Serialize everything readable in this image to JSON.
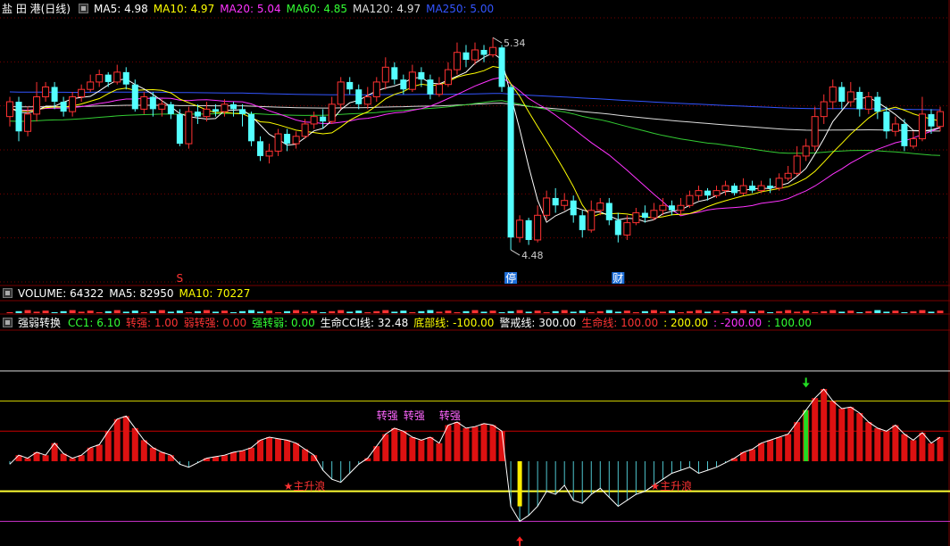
{
  "header_main": {
    "stock_name": "盐 田 港(日线)",
    "items": [
      {
        "label": "MA5: ",
        "value": "4.98",
        "color": "#ffffff"
      },
      {
        "label": "MA10: ",
        "value": "4.97",
        "color": "#ffff00"
      },
      {
        "label": "MA20: ",
        "value": "5.04",
        "color": "#ff33ff"
      },
      {
        "label": "MA60: ",
        "value": "4.85",
        "color": "#33ff33"
      },
      {
        "label": "MA120: ",
        "value": "4.97",
        "color": "#dddddd"
      },
      {
        "label": "MA250: ",
        "value": "5.00",
        "color": "#3355ff"
      }
    ]
  },
  "header_volume": {
    "items": [
      {
        "label": "VOLUME: ",
        "value": "64322",
        "color": "#ffffff"
      },
      {
        "label": "MA5: ",
        "value": "82950",
        "color": "#ffffff"
      },
      {
        "label": "MA10: ",
        "value": "70227",
        "color": "#ffff00"
      }
    ]
  },
  "header_indicator": {
    "name": "强弱转换",
    "items": [
      {
        "label": "CC1: ",
        "value": "6.10",
        "color": "#33ff33"
      },
      {
        "label": "转强: ",
        "value": "1.00",
        "color": "#ff3333"
      },
      {
        "label": "弱转强: ",
        "value": "0.00",
        "color": "#ff3333"
      },
      {
        "label": "强转弱: ",
        "value": "0.00",
        "color": "#33ff33"
      },
      {
        "label": "生命CCI线: ",
        "value": "32.48",
        "color": "#ffffff"
      },
      {
        "label": "底部线: ",
        "value": "-100.00",
        "color": "#ffff00"
      },
      {
        "label": "警戒线: ",
        "value": "300.00",
        "color": "#ffffff"
      },
      {
        "label": "生命线: ",
        "value": "100.00",
        "color": "#ff3333"
      },
      {
        "label": ": ",
        "value": "200.00",
        "color": "#ffff00"
      },
      {
        "label": ": ",
        "value": "-200.00",
        "color": "#ff33ff"
      },
      {
        "label": ": ",
        "value": "100.00",
        "color": "#33ff33"
      }
    ]
  },
  "annotations": {
    "high_label": "5.34",
    "low_label": "4.48",
    "marker_s": "S",
    "marker_ting": "停",
    "marker_cai": "财",
    "signal_1": "主升浪",
    "signal_2": "主升浪",
    "text_a": "转强",
    "text_b": "转强",
    "text_c": "转强"
  },
  "colors": {
    "up": "#ff3232",
    "down": "#54ffff",
    "ma5": "#ffffff",
    "ma10": "#ffff00",
    "ma20": "#ff33ff",
    "ma60": "#33cc33",
    "ma120": "#dddddd",
    "ma250": "#3355ff",
    "grid": "#7a0000",
    "frame": "#7a0000"
  },
  "chart_data": {
    "type": "candlestick",
    "ylim": [
      4.35,
      5.42
    ],
    "high": 5.34,
    "low": 4.48,
    "candles": [
      [
        5.02,
        5.08,
        4.98,
        5.1
      ],
      [
        5.08,
        4.96,
        4.92,
        5.1
      ],
      [
        4.96,
        5.03,
        4.94,
        5.06
      ],
      [
        5.03,
        5.1,
        5.0,
        5.16
      ],
      [
        5.1,
        5.14,
        5.08,
        5.16
      ],
      [
        5.14,
        5.08,
        5.05,
        5.16
      ],
      [
        5.08,
        5.04,
        5.02,
        5.1
      ],
      [
        5.04,
        5.1,
        5.02,
        5.12
      ],
      [
        5.1,
        5.13,
        5.08,
        5.15
      ],
      [
        5.13,
        5.16,
        5.12,
        5.19
      ],
      [
        5.16,
        5.19,
        5.14,
        5.21
      ],
      [
        5.19,
        5.16,
        5.14,
        5.2
      ],
      [
        5.16,
        5.2,
        5.15,
        5.23
      ],
      [
        5.2,
        5.15,
        5.13,
        5.22
      ],
      [
        5.15,
        5.05,
        5.04,
        5.17
      ],
      [
        5.05,
        5.1,
        5.03,
        5.12
      ],
      [
        5.1,
        5.05,
        5.02,
        5.12
      ],
      [
        5.05,
        5.07,
        5.02,
        5.09
      ],
      [
        5.07,
        5.03,
        5.01,
        5.08
      ],
      [
        5.03,
        4.91,
        4.9,
        5.05
      ],
      [
        4.91,
        5.04,
        4.89,
        5.06
      ],
      [
        5.04,
        5.02,
        4.99,
        5.07
      ],
      [
        5.02,
        5.05,
        5.0,
        5.08
      ],
      [
        5.05,
        5.04,
        5.02,
        5.07
      ],
      [
        5.04,
        5.07,
        5.02,
        5.09
      ],
      [
        5.07,
        5.05,
        5.02,
        5.08
      ],
      [
        5.05,
        5.03,
        4.98,
        5.07
      ],
      [
        5.03,
        4.92,
        4.9,
        5.04
      ],
      [
        4.92,
        4.86,
        4.84,
        4.94
      ],
      [
        4.86,
        4.88,
        4.83,
        4.91
      ],
      [
        4.88,
        4.95,
        4.86,
        4.97
      ],
      [
        4.95,
        4.91,
        4.88,
        4.97
      ],
      [
        4.91,
        4.94,
        4.89,
        4.96
      ],
      [
        4.94,
        4.99,
        4.93,
        5.01
      ],
      [
        4.99,
        5.02,
        4.97,
        5.04
      ],
      [
        5.02,
        5.0,
        4.97,
        5.05
      ],
      [
        5.0,
        5.07,
        4.99,
        5.1
      ],
      [
        5.07,
        5.16,
        5.05,
        5.18
      ],
      [
        5.16,
        5.13,
        5.11,
        5.18
      ],
      [
        5.13,
        5.07,
        5.05,
        5.15
      ],
      [
        5.07,
        5.1,
        5.05,
        5.14
      ],
      [
        5.1,
        5.16,
        5.08,
        5.18
      ],
      [
        5.16,
        5.22,
        5.13,
        5.26
      ],
      [
        5.22,
        5.17,
        5.15,
        5.24
      ],
      [
        5.17,
        5.13,
        5.11,
        5.19
      ],
      [
        5.13,
        5.2,
        5.12,
        5.23
      ],
      [
        5.2,
        5.17,
        5.14,
        5.22
      ],
      [
        5.17,
        5.11,
        5.09,
        5.19
      ],
      [
        5.11,
        5.15,
        5.1,
        5.18
      ],
      [
        5.15,
        5.21,
        5.14,
        5.24
      ],
      [
        5.21,
        5.28,
        5.19,
        5.32
      ],
      [
        5.28,
        5.25,
        5.22,
        5.31
      ],
      [
        5.25,
        5.29,
        5.23,
        5.32
      ],
      [
        5.29,
        5.27,
        5.24,
        5.31
      ],
      [
        5.27,
        5.3,
        5.26,
        5.34
      ],
      [
        5.3,
        5.14,
        5.12,
        5.31
      ],
      [
        5.14,
        4.53,
        4.48,
        5.15
      ],
      [
        4.53,
        4.6,
        4.51,
        4.62
      ],
      [
        4.6,
        4.52,
        4.5,
        4.61
      ],
      [
        4.52,
        4.62,
        4.51,
        4.66
      ],
      [
        4.62,
        4.69,
        4.6,
        4.72
      ],
      [
        4.69,
        4.66,
        4.63,
        4.73
      ],
      [
        4.66,
        4.68,
        4.64,
        4.71
      ],
      [
        4.68,
        4.62,
        4.59,
        4.7
      ],
      [
        4.62,
        4.56,
        4.53,
        4.64
      ],
      [
        4.56,
        4.64,
        4.55,
        4.68
      ],
      [
        4.64,
        4.67,
        4.62,
        4.69
      ],
      [
        4.67,
        4.6,
        4.58,
        4.69
      ],
      [
        4.6,
        4.54,
        4.51,
        4.63
      ],
      [
        4.54,
        4.59,
        4.52,
        4.62
      ],
      [
        4.59,
        4.63,
        4.58,
        4.65
      ],
      [
        4.63,
        4.61,
        4.59,
        4.66
      ],
      [
        4.61,
        4.64,
        4.6,
        4.67
      ],
      [
        4.64,
        4.66,
        4.62,
        4.69
      ],
      [
        4.66,
        4.64,
        4.62,
        4.68
      ],
      [
        4.64,
        4.66,
        4.62,
        4.69
      ],
      [
        4.66,
        4.7,
        4.65,
        4.72
      ],
      [
        4.7,
        4.72,
        4.68,
        4.74
      ],
      [
        4.72,
        4.7,
        4.68,
        4.73
      ],
      [
        4.7,
        4.72,
        4.69,
        4.74
      ],
      [
        4.72,
        4.74,
        4.7,
        4.76
      ],
      [
        4.74,
        4.71,
        4.7,
        4.75
      ],
      [
        4.71,
        4.74,
        4.7,
        4.77
      ],
      [
        4.74,
        4.72,
        4.71,
        4.76
      ],
      [
        4.72,
        4.74,
        4.71,
        4.76
      ],
      [
        4.74,
        4.73,
        4.71,
        4.77
      ],
      [
        4.73,
        4.77,
        4.72,
        4.79
      ],
      [
        4.77,
        4.79,
        4.76,
        4.82
      ],
      [
        4.79,
        4.86,
        4.78,
        4.9
      ],
      [
        4.86,
        4.9,
        4.84,
        4.93
      ],
      [
        4.9,
        5.02,
        4.88,
        5.06
      ],
      [
        5.02,
        5.08,
        4.99,
        5.11
      ],
      [
        5.08,
        5.14,
        5.05,
        5.17
      ],
      [
        5.14,
        5.08,
        5.05,
        5.16
      ],
      [
        5.08,
        5.12,
        5.06,
        5.16
      ],
      [
        5.12,
        5.05,
        5.02,
        5.14
      ],
      [
        5.05,
        5.1,
        5.03,
        5.12
      ],
      [
        5.1,
        5.04,
        5.01,
        5.12
      ],
      [
        5.04,
        4.96,
        4.93,
        5.06
      ],
      [
        4.96,
        4.99,
        4.94,
        5.02
      ],
      [
        4.99,
        4.9,
        4.88,
        5.01
      ],
      [
        4.9,
        4.93,
        4.89,
        4.96
      ],
      [
        4.93,
        5.03,
        4.92,
        5.1
      ],
      [
        5.03,
        4.98,
        4.95,
        5.05
      ],
      [
        4.98,
        5.04,
        4.96,
        5.06
      ]
    ],
    "cci": [
      -10,
      20,
      10,
      30,
      20,
      60,
      25,
      10,
      20,
      45,
      55,
      100,
      140,
      150,
      110,
      70,
      45,
      30,
      20,
      -10,
      -20,
      -5,
      10,
      15,
      20,
      30,
      35,
      45,
      70,
      80,
      75,
      70,
      60,
      40,
      20,
      -30,
      -60,
      -70,
      -40,
      -10,
      10,
      50,
      90,
      110,
      100,
      80,
      70,
      80,
      60,
      120,
      130,
      110,
      115,
      125,
      120,
      100,
      -150,
      -200,
      -180,
      -150,
      -100,
      -110,
      -80,
      -130,
      -140,
      -110,
      -90,
      -120,
      -150,
      -130,
      -110,
      -100,
      -80,
      -60,
      -40,
      -30,
      -20,
      -40,
      -30,
      -20,
      -5,
      10,
      30,
      40,
      60,
      70,
      80,
      90,
      130,
      170,
      210,
      240,
      200,
      175,
      180,
      160,
      130,
      110,
      100,
      120,
      90,
      70,
      95,
      60,
      80
    ]
  }
}
